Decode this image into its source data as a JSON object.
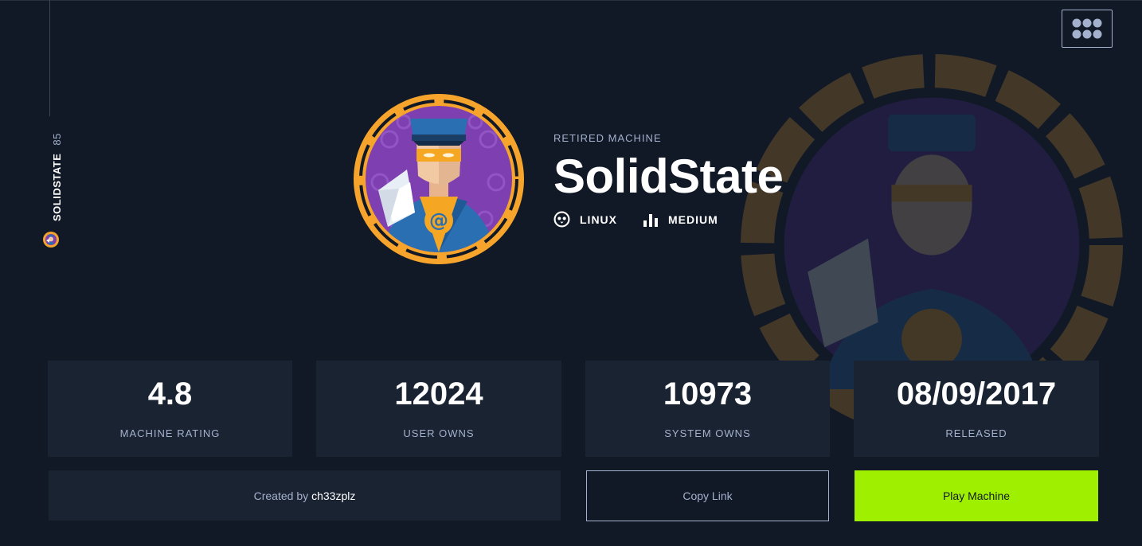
{
  "sidebar": {
    "machine_name": "SOLIDSTATE",
    "machine_number": "85"
  },
  "header": {
    "apps_icon": "grid-dots-icon"
  },
  "machine": {
    "status": "RETIRED MACHINE",
    "name": "SolidState",
    "os": {
      "label": "LINUX",
      "icon": "linux-tux-icon"
    },
    "difficulty": {
      "label": "MEDIUM",
      "icon": "difficulty-bars-icon"
    },
    "avatar": "solidstate-mailman-avatar"
  },
  "stats": [
    {
      "value": "4.8",
      "label": "MACHINE RATING"
    },
    {
      "value": "12024",
      "label": "USER OWNS"
    },
    {
      "value": "10973",
      "label": "SYSTEM OWNS"
    },
    {
      "value": "08/09/2017",
      "label": "RELEASED"
    }
  ],
  "actions": {
    "created_by_prefix": "Created by",
    "author": "ch33zplz",
    "copy_link": "Copy Link",
    "play": "Play Machine"
  },
  "colors": {
    "background": "#111927",
    "card": "#1a2332",
    "muted_text": "#a4b1cd",
    "accent_green": "#9fef00",
    "avatar_ring": "#f6a42c",
    "avatar_bg": "#7e3fb1"
  }
}
